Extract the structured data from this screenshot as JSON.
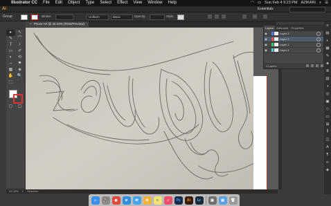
{
  "menubar": {
    "items": [
      "Illustrator CC",
      "File",
      "Edit",
      "Object",
      "Type",
      "Select",
      "Effect",
      "View",
      "Window",
      "Help"
    ],
    "clock": "Sun Feb 4  9:23 PM",
    "user": "AZIKARI"
  },
  "appbar": {
    "logo": "Ai",
    "workspace": "Essentials"
  },
  "control": {
    "selection": "Group",
    "stroke_label": "Stroke:",
    "style_label": "Style:",
    "opacity_label": "Opacity:",
    "uniform": "Uniform",
    "basic": "Basic"
  },
  "document": {
    "tab_title": "Phone Art @ 33.33% (RGB/Preview)",
    "close": "×"
  },
  "tools": [
    "▸",
    "↖",
    "✎",
    "⌒",
    "T",
    "/",
    "▭",
    "✐",
    "◐",
    "⟲",
    "⇔",
    "⚑",
    "▦",
    "◈",
    "✋",
    "🔍",
    "⬚",
    "⬛"
  ],
  "canvas": {
    "background": "#cac6bd"
  },
  "layers_panel": {
    "tabs": [
      "Layers",
      "Artboards",
      "Properties"
    ],
    "layers": [
      {
        "name": "Layer 3",
        "color": "#4f7fff"
      },
      {
        "name": "Layer 2",
        "color": "#ff4f4f"
      },
      {
        "name": "Layer 1",
        "color": "#2fcf5f"
      },
      {
        "name": "Layer 4",
        "color": "#4fcfcf"
      }
    ],
    "count": "4 Layers"
  },
  "status": {
    "zoom": "33.33%",
    "artboard": "1",
    "info": "Selection"
  },
  "dock_apps": [
    {
      "name": "Finder",
      "label": "☺",
      "color": "#3b8fe8"
    },
    {
      "name": "Launchpad",
      "label": "🚀",
      "color": "#8a8a8a"
    },
    {
      "name": "Chrome",
      "label": "◉",
      "color": "#e0483e"
    },
    {
      "name": "Safari",
      "label": "⊘",
      "color": "#2e8fe0"
    },
    {
      "name": "Mail",
      "label": "✉",
      "color": "#4aa3e8"
    },
    {
      "name": "Photos",
      "label": "✿",
      "color": "#f2b23a"
    },
    {
      "name": "Notes",
      "label": "≡",
      "color": "#f2e27a"
    },
    {
      "name": "Music",
      "label": "♫",
      "color": "#ef4f6a"
    },
    {
      "name": "Photoshop",
      "label": "Ps",
      "color": "#1b2a48"
    },
    {
      "name": "Illustrator",
      "label": "Ai",
      "color": "#3a1c0c"
    },
    {
      "name": "Lightroom",
      "label": "Lr",
      "color": "#1b2a3a"
    },
    {
      "name": "Preview",
      "label": "▣",
      "color": "#6f6f6f"
    },
    {
      "name": "Folder",
      "label": "▤",
      "color": "#5aa0e0"
    },
    {
      "name": "Trash",
      "label": "🗑",
      "color": "#9a9a9a"
    }
  ]
}
